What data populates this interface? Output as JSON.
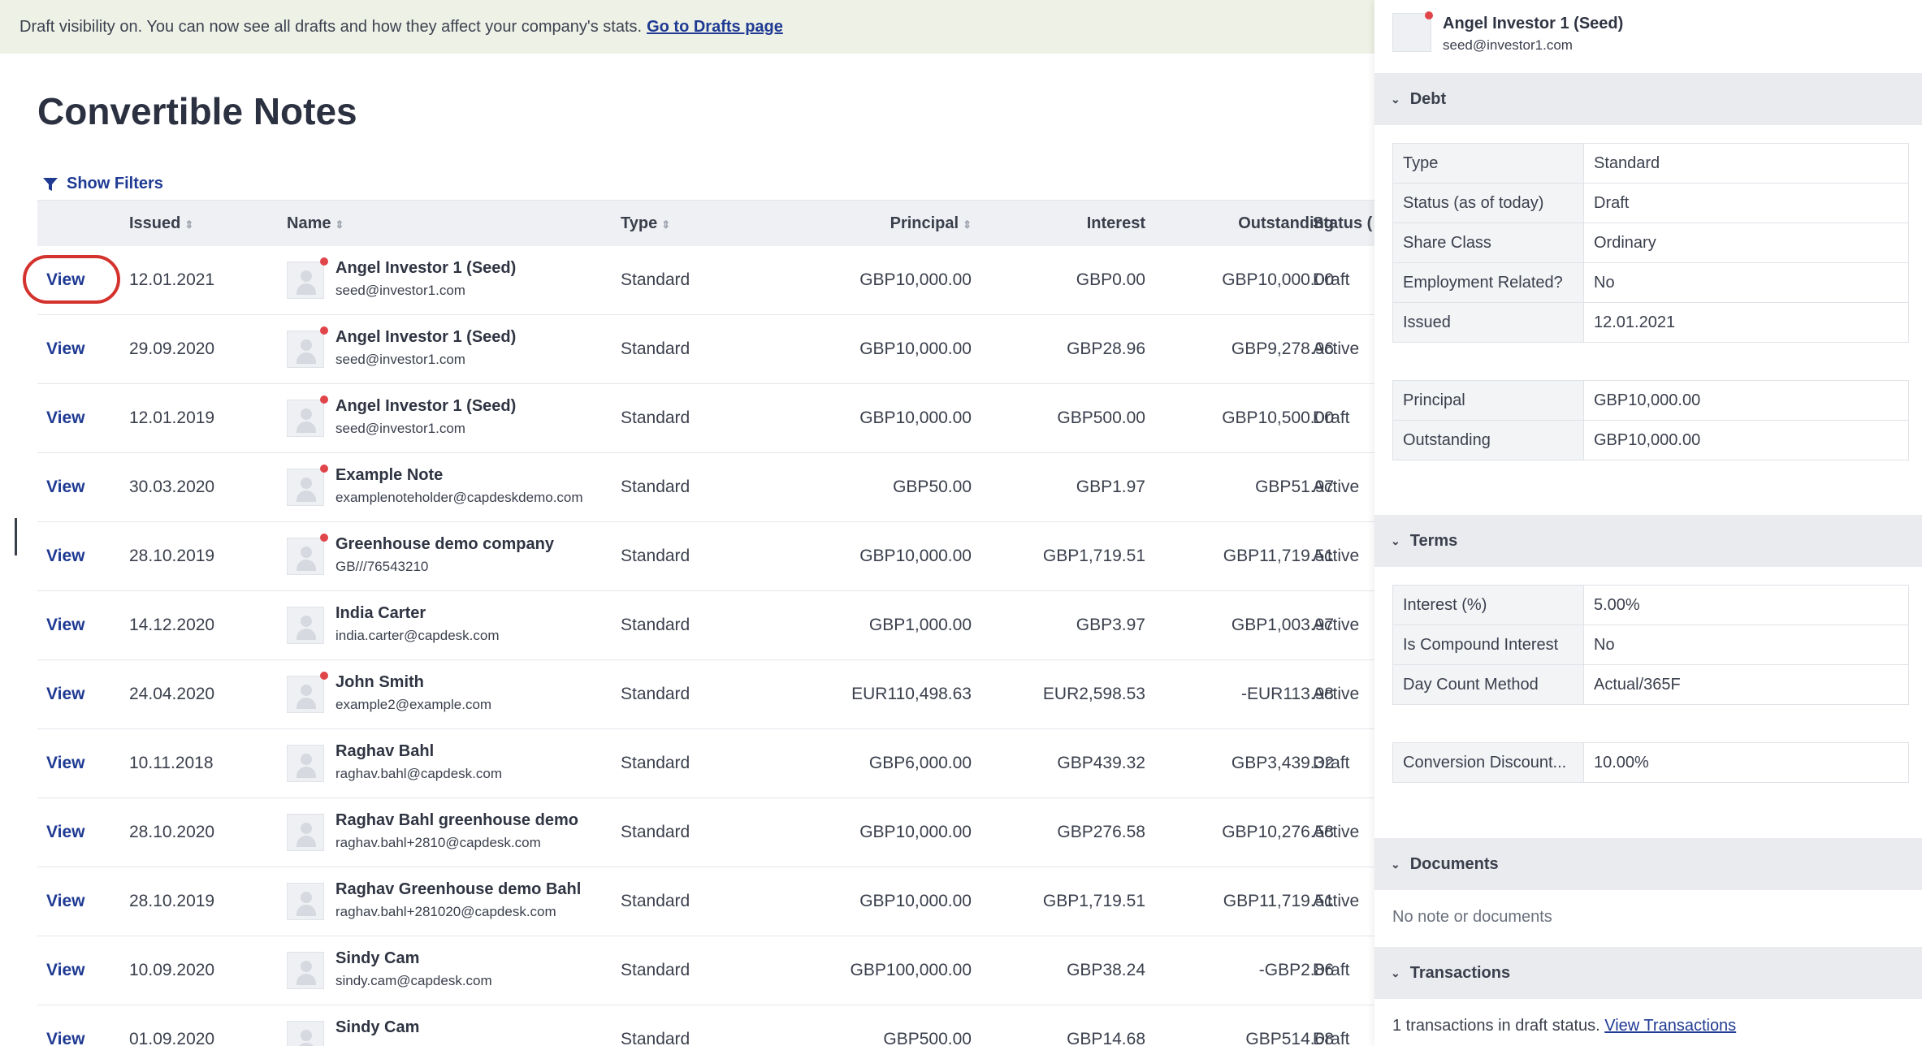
{
  "banner": {
    "text": "Draft visibility on. You can now see all drafts and how they affect your company's stats.",
    "link": "Go to Drafts page"
  },
  "page_title": "Convertible Notes",
  "filters_label": "Show Filters",
  "table": {
    "headers": {
      "issued": "Issued",
      "name": "Name",
      "type": "Type",
      "principal": "Principal",
      "interest": "Interest",
      "outstanding": "Outstanding",
      "status": "Status ("
    },
    "view_label": "View",
    "rows": [
      {
        "issued": "12.01.2021",
        "name": "Angel Investor 1 (Seed)",
        "email": "seed@investor1.com",
        "type": "Standard",
        "principal": "GBP10,000.00",
        "interest": "GBP0.00",
        "outstanding": "GBP10,000.00",
        "status": "Draft",
        "dot": true,
        "highlighted": true
      },
      {
        "issued": "29.09.2020",
        "name": "Angel Investor 1 (Seed)",
        "email": "seed@investor1.com",
        "type": "Standard",
        "principal": "GBP10,000.00",
        "interest": "GBP28.96",
        "outstanding": "GBP9,278.96",
        "status": "Active",
        "dot": true
      },
      {
        "issued": "12.01.2019",
        "name": "Angel Investor 1 (Seed)",
        "email": "seed@investor1.com",
        "type": "Standard",
        "principal": "GBP10,000.00",
        "interest": "GBP500.00",
        "outstanding": "GBP10,500.00",
        "status": "Draft",
        "dot": true
      },
      {
        "issued": "30.03.2020",
        "name": "Example Note",
        "email": "examplenoteholder@capdeskdemo.com",
        "type": "Standard",
        "principal": "GBP50.00",
        "interest": "GBP1.97",
        "outstanding": "GBP51.97",
        "status": "Active",
        "dot": true
      },
      {
        "issued": "28.10.2019",
        "name": "Greenhouse demo company",
        "email": "GB///76543210",
        "type": "Standard",
        "principal": "GBP10,000.00",
        "interest": "GBP1,719.51",
        "outstanding": "GBP11,719.51",
        "status": "Active",
        "dot": true
      },
      {
        "issued": "14.12.2020",
        "name": "India Carter",
        "email": "india.carter@capdesk.com",
        "type": "Standard",
        "principal": "GBP1,000.00",
        "interest": "GBP3.97",
        "outstanding": "GBP1,003.97",
        "status": "Active",
        "dot": false
      },
      {
        "issued": "24.04.2020",
        "name": "John Smith",
        "email": "example2@example.com",
        "type": "Standard",
        "principal": "EUR110,498.63",
        "interest": "EUR2,598.53",
        "outstanding": "-EUR113.98",
        "status": "Active",
        "dot": true
      },
      {
        "issued": "10.11.2018",
        "name": "Raghav Bahl",
        "email": "raghav.bahl@capdesk.com",
        "type": "Standard",
        "principal": "GBP6,000.00",
        "interest": "GBP439.32",
        "outstanding": "GBP3,439.32",
        "status": "Draft",
        "dot": false
      },
      {
        "issued": "28.10.2020",
        "name": "Raghav Bahl greenhouse demo",
        "email": "raghav.bahl+2810@capdesk.com",
        "type": "Standard",
        "principal": "GBP10,000.00",
        "interest": "GBP276.58",
        "outstanding": "GBP10,276.58",
        "status": "Active",
        "dot": false
      },
      {
        "issued": "28.10.2019",
        "name": "Raghav Greenhouse demo Bahl",
        "email": "raghav.bahl+281020@capdesk.com",
        "type": "Standard",
        "principal": "GBP10,000.00",
        "interest": "GBP1,719.51",
        "outstanding": "GBP11,719.51",
        "status": "Active",
        "dot": false
      },
      {
        "issued": "10.09.2020",
        "name": "Sindy Cam",
        "email": "sindy.cam@capdesk.com",
        "type": "Standard",
        "principal": "GBP100,000.00",
        "interest": "GBP38.24",
        "outstanding": "-GBP2.86",
        "status": "Draft",
        "dot": false
      },
      {
        "issued": "01.09.2020",
        "name": "Sindy Cam",
        "email": "",
        "type": "Standard",
        "principal": "GBP500.00",
        "interest": "GBP14.68",
        "outstanding": "GBP514.68",
        "status": "Draft",
        "dot": false
      }
    ]
  },
  "panel": {
    "holder_name": "Angel Investor 1 (Seed)",
    "holder_email": "seed@investor1.com",
    "sections": {
      "debt": "Debt",
      "terms": "Terms",
      "documents": "Documents",
      "transactions": "Transactions"
    },
    "debt_rows": [
      {
        "k": "Type",
        "v": "Standard"
      },
      {
        "k": "Status (as of today)",
        "v": "Draft"
      },
      {
        "k": "Share Class",
        "v": "Ordinary"
      },
      {
        "k": "Employment Related?",
        "v": "No"
      },
      {
        "k": "Issued",
        "v": "12.01.2021"
      }
    ],
    "amount_rows": [
      {
        "k": "Principal",
        "v": "GBP10,000.00"
      },
      {
        "k": "Outstanding",
        "v": "GBP10,000.00"
      }
    ],
    "terms_rows": [
      {
        "k": "Interest (%)",
        "v": "5.00%"
      },
      {
        "k": "Is Compound Interest",
        "v": "No"
      },
      {
        "k": "Day Count Method",
        "v": "Actual/365F"
      }
    ],
    "conversion_rows": [
      {
        "k": "Conversion Discount...",
        "v": "10.00%"
      }
    ],
    "documents_note": "No note or documents",
    "transactions_note": "1 transactions in draft status.",
    "transactions_link": "View Transactions"
  },
  "colors": {
    "accent": "#1f3a93",
    "banner_bg": "#eef1e6",
    "highlight": "#d3322d",
    "dot": "#e0454a"
  }
}
